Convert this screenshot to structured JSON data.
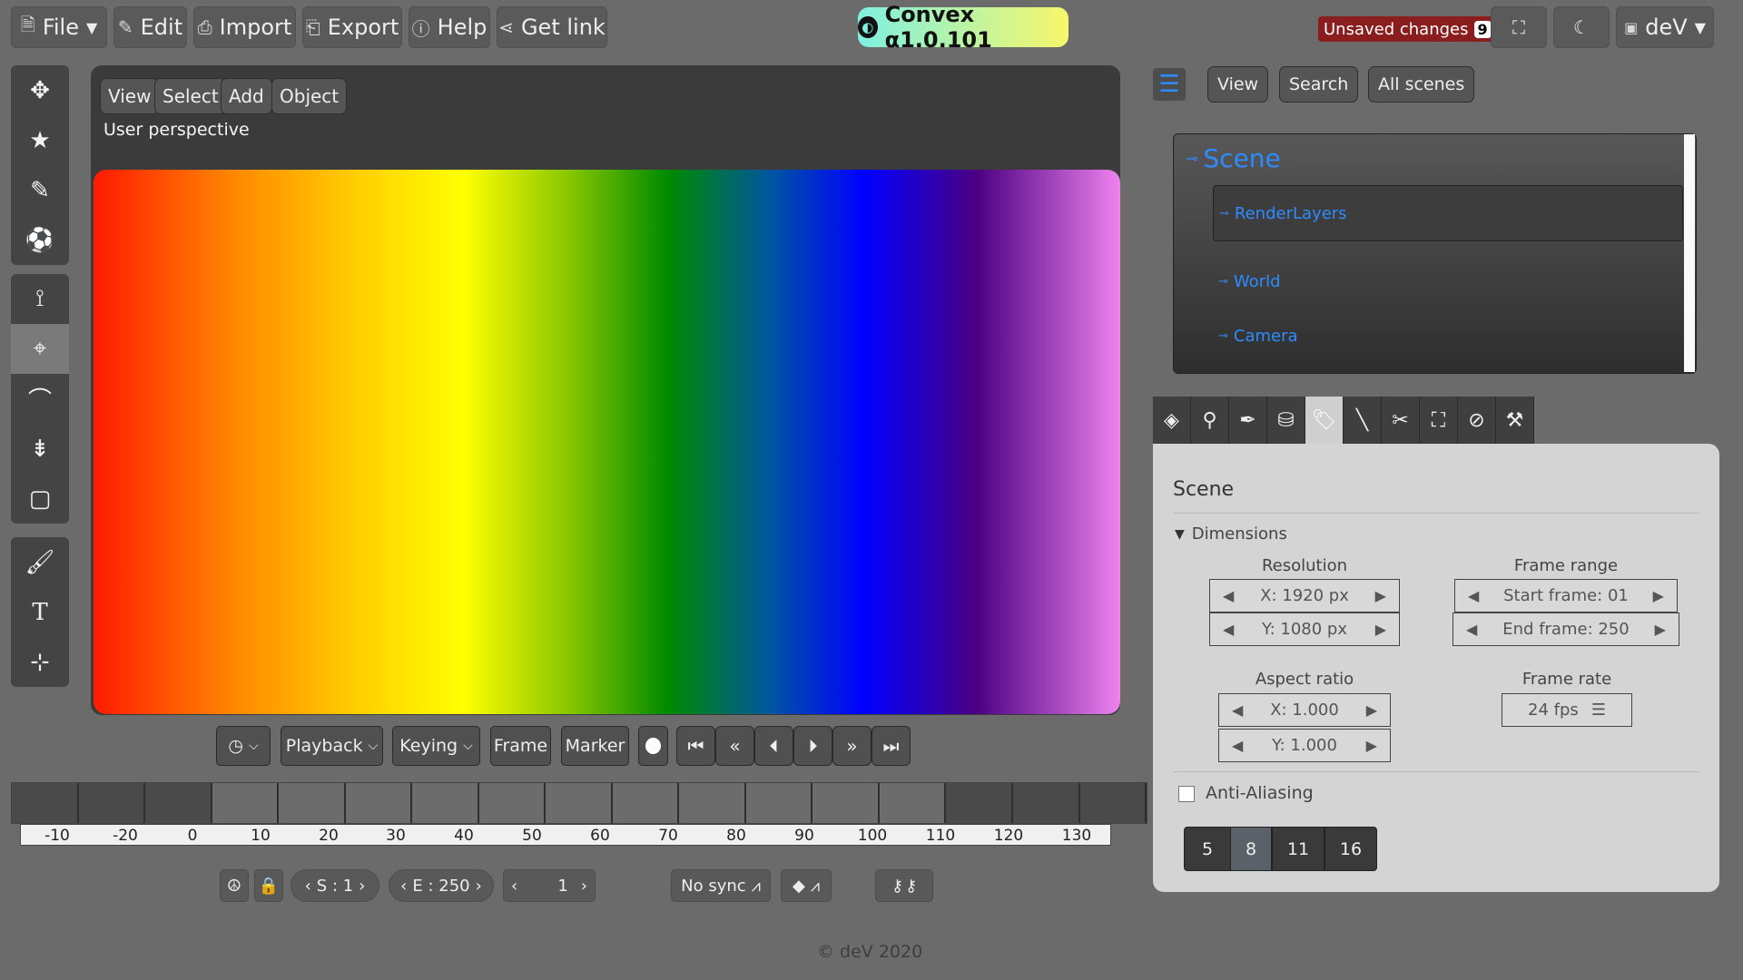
{
  "menubar": {
    "file": "File",
    "edit": "Edit",
    "import": "Import",
    "export": "Export",
    "help": "Help",
    "get_link": "Get link"
  },
  "version": "Convex α1.0.101",
  "unsaved": {
    "label": "Unsaved changes",
    "count": "9"
  },
  "user": {
    "name": "deV"
  },
  "viewport": {
    "menus": [
      "View",
      "Select",
      "Add",
      "Object"
    ],
    "perspective": "User perspective"
  },
  "playback": {
    "playback": "Playback",
    "keying": "Keying",
    "frame": "Frame",
    "marker": "Marker"
  },
  "timeline": {
    "ticks": [
      "-10",
      "-20",
      "0",
      "10",
      "20",
      "30",
      "40",
      "50",
      "60",
      "70",
      "80",
      "90",
      "100",
      "110",
      "120",
      "130"
    ]
  },
  "bottom": {
    "start": "S : 1",
    "end": "E : 250",
    "current": "1",
    "sync": "No sync"
  },
  "footer": "© deV 2020",
  "outliner": {
    "view": "View",
    "search": "Search",
    "all_scenes": "All scenes",
    "scene": "Scene",
    "nodes": [
      "RenderLayers",
      "World",
      "Camera"
    ]
  },
  "properties": {
    "title": "Scene",
    "section": "Dimensions",
    "resolution_label": "Resolution",
    "res_x": "X: 1920 px",
    "res_y": "Y: 1080 px",
    "frame_range_label": "Frame range",
    "start_frame": "Start frame: 01",
    "end_frame": "End frame: 250",
    "aspect_label": "Aspect ratio",
    "aspect_x": "X: 1.000",
    "aspect_y": "Y: 1.000",
    "frame_rate_label": "Frame rate",
    "fps": "24 fps",
    "anti_aliasing": "Anti-Aliasing",
    "aa_options": [
      "5",
      "8",
      "11",
      "16"
    ],
    "aa_selected": "8"
  }
}
